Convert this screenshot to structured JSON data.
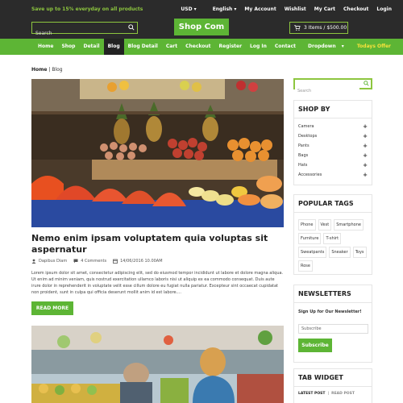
{
  "topbar": {
    "promo": "Save up to 15% everyday on all products",
    "links": [
      "USD",
      "English",
      "My Account",
      "Wishlist",
      "My Cart",
      "Checkout",
      "Login"
    ],
    "search_placeholder": "Search",
    "logo": "Shop Com",
    "cart": "3 Items / $500.00"
  },
  "nav": {
    "items": [
      "Home",
      "Shop",
      "Detail",
      "Blog",
      "Blog Detail",
      "Cart",
      "Checkout",
      "Register",
      "Log In",
      "Contact",
      "Dropdown"
    ],
    "active_index": 3,
    "today_offer": "Todays Offer"
  },
  "breadcrumb": {
    "home": "Home",
    "sep": " | ",
    "current": "Blog"
  },
  "post": {
    "title": "Nemo enim ipsam voluptatem quia voluptas sit aspernatur",
    "author": "Dapibus Diam",
    "comments": "4 Comments",
    "date": "14/06/2016 10.00AM",
    "excerpt": "Lorem ipsum dolor sit amet, consectetur adipiscing elit, sed do eiusmod tempor incididunt ut labore et dolore magna aliqua. Ut enim ad minim veniam, quis nostrud exercitation ullamco laboris nisi ut aliquip ex ea commodo consequat. Duis aute irure dolor in reprehenderit in voluptate velit esse cillum dolore eu fugiat nulla pariatur. Excepteur sint occaecat cupidatat non proident, sunt in culpa qui officia deserunt mollit anim id est labore....",
    "read_more": "READ MORE"
  },
  "sidebar": {
    "search_placeholder": "Search",
    "shop_by": {
      "title": "SHOP BY",
      "items": [
        "Camera",
        "Desktops",
        "Pants",
        "Bags",
        "Hats",
        "Accessories"
      ]
    },
    "tags": {
      "title": "POPULAR TAGS",
      "items": [
        "Phone",
        "Vest",
        "Smartphone",
        "Furniture",
        "T-shirt",
        "Sweatpants",
        "Sneaker",
        "Toys",
        "Rose"
      ]
    },
    "newsletters": {
      "title": "NEWSLETTERS",
      "text": "Sign Up for Our Newsletter!",
      "placeholder": "Subscribe",
      "button": "Subscribe"
    },
    "tab_widget": {
      "title": "TAB WIDGET",
      "tab1": "LATEST POST",
      "sep": "|",
      "tab2": "READ POST"
    }
  },
  "colors": {
    "accent": "#5db535",
    "dark": "#2b2b2b",
    "offer": "#f5e23b"
  }
}
